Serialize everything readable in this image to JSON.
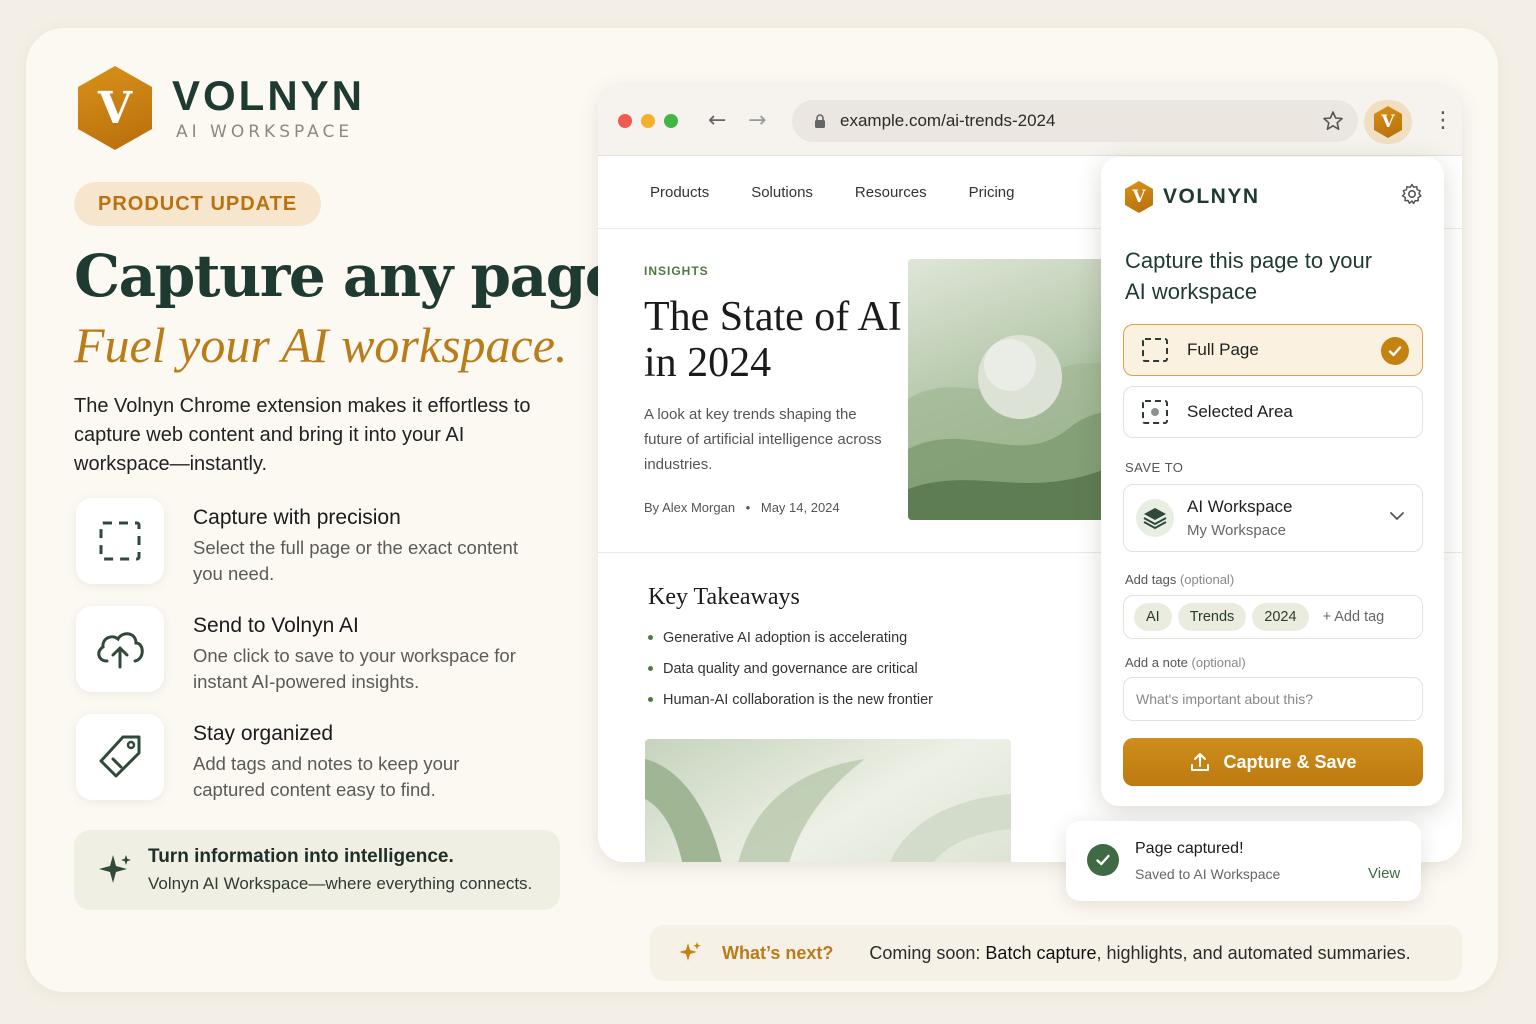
{
  "brand": {
    "name": "VOLNYN",
    "sub": "AI WORKSPACE",
    "mark": "V"
  },
  "badge": "PRODUCT UPDATE",
  "headline": {
    "line1": "Capture any page.",
    "line2": "Fuel your AI workspace."
  },
  "intro": "The Volnyn Chrome extension makes it effortless to capture web content and bring it into your AI workspace—instantly.",
  "features": [
    {
      "icon": "dashed-frame-icon",
      "title": "Capture with precision",
      "desc": "Select the full page or the exact content you need."
    },
    {
      "icon": "cloud-upload-icon",
      "title": "Send to Volnyn AI",
      "desc": "One click to save to your workspace for instant AI-powered insights."
    },
    {
      "icon": "tag-icon",
      "title": "Stay organized",
      "desc": "Add tags and notes to keep your captured content easy to find."
    }
  ],
  "banner": {
    "icon": "sparkle-icon",
    "title": "Turn information into intelligence.",
    "sub": "Volnyn AI Workspace—where everything connects."
  },
  "browser": {
    "url": "example.com/ai-trends-2024",
    "nav": [
      "Products",
      "Solutions",
      "Resources",
      "Pricing"
    ],
    "article": {
      "kicker": "INSIGHTS",
      "title": "The State of AI in 2024",
      "dek": "A look at key trends shaping the future of artificial intelligence across industries.",
      "author": "By Alex Morgan",
      "date": "May 14, 2024"
    },
    "takeaways": {
      "title": "Key Takeaways",
      "items": [
        "Generative AI adoption is accelerating",
        "Data quality and governance are critical",
        "Human-AI collaboration is the new frontier"
      ]
    }
  },
  "popup": {
    "brand": "VOLNYN",
    "title": "Capture this page to your AI workspace",
    "options": [
      {
        "label": "Full Page",
        "selected": true
      },
      {
        "label": "Selected Area",
        "selected": false
      }
    ],
    "save_to_label": "SAVE TO",
    "workspace": {
      "name": "AI Workspace",
      "sub": "My Workspace"
    },
    "tags_label": "Add tags",
    "tags_optional": "(optional)",
    "tags": [
      "AI",
      "Trends",
      "2024"
    ],
    "add_tag": "+ Add tag",
    "note_label": "Add a note",
    "note_optional": "(optional)",
    "note_placeholder": "What's important about this?",
    "cta": "Capture & Save"
  },
  "toast": {
    "title": "Page captured!",
    "sub": "Saved to AI Workspace",
    "action": "View"
  },
  "next": {
    "title": "What’s next?",
    "prefix": "Coming soon:",
    "highlight": "Batch capture",
    "rest": ", highlights, and automated summaries."
  },
  "colors": {
    "accent": "#c4830f",
    "brand_dark": "#1f3a30",
    "green": "#3f6a45",
    "background": "#fcf9f3"
  }
}
